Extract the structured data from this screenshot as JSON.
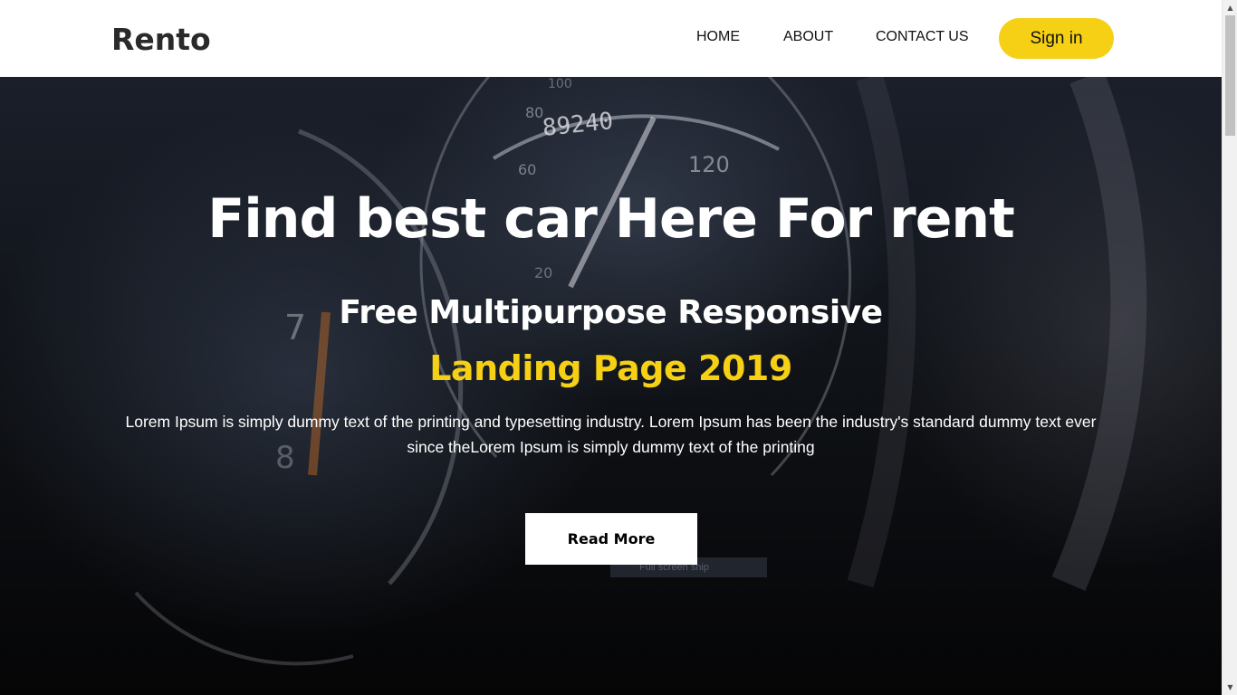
{
  "header": {
    "logo": "Rento",
    "nav": [
      {
        "label": "HOME"
      },
      {
        "label": "ABOUT"
      },
      {
        "label": "CONTACT US"
      }
    ],
    "signin_label": "Sign in"
  },
  "hero": {
    "title": "Find best car Here For rent",
    "subtitle_line1": "Free Multipurpose Responsive",
    "subtitle_line2": "Landing Page 2019",
    "description": "Lorem Ipsum is simply dummy text of the printing and typesetting industry. Lorem Ipsum has been the industry's standard dummy text ever since theLorem Ipsum is simply dummy text of the printing",
    "read_more_label": "Read More",
    "fullscreen_chip": "Full screen snip"
  },
  "background": {
    "odometer": "89240",
    "gauge_labels": [
      "80",
      "60",
      "120",
      "100",
      "20",
      "7",
      "8"
    ]
  },
  "colors": {
    "accent": "#f5d015",
    "hero_text": "#ffffff",
    "header_bg": "#ffffff"
  },
  "scrollbar": {
    "up_icon": "scroll-up-arrow-icon",
    "down_icon": "scroll-down-arrow-icon"
  }
}
